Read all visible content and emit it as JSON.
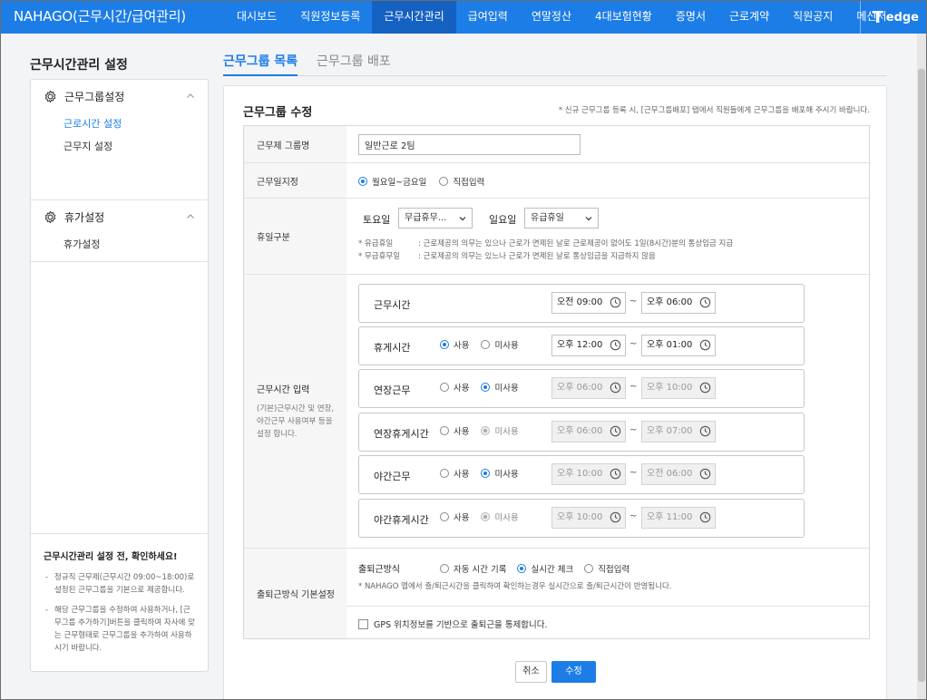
{
  "app": {
    "brand": "NAHAGO(근무시간/급여관리)",
    "logo_text": "edge"
  },
  "nav": [
    {
      "label": "대시보드"
    },
    {
      "label": "직원정보등록"
    },
    {
      "label": "근무시간관리"
    },
    {
      "label": "급여입력"
    },
    {
      "label": "연말정산"
    },
    {
      "label": "4대보험현황"
    },
    {
      "label": "증명서"
    },
    {
      "label": "근로계약"
    },
    {
      "label": "직원공지"
    },
    {
      "label": "메신저"
    }
  ],
  "nav_active": "근무시간관리",
  "sidebar": {
    "title": "근무시간관리 설정",
    "groups": [
      {
        "label": "근무그룹설정",
        "items": [
          "근로시간 설정",
          "근무지 설정"
        ]
      },
      {
        "label": "휴가설정",
        "items": [
          "휴가설정"
        ]
      }
    ],
    "active_item": "근로시간 설정",
    "notice": {
      "title": "근무시간관리 설정 전, 확인하세요!",
      "items": [
        "정규직 근무제(근무시간 09:00~18:00)로 설정된 근무그룹을 기본으로 제공합니다.",
        "해당 근무그룹을 수정하여 사용하거나, [근무그룹 추가하기]버튼을 클릭하여 자사에 맞는 근무형태로 근무그룹을 추가하여 사용하시기 바랍니다."
      ]
    }
  },
  "tabs": [
    {
      "label": "근무그룹 목록"
    },
    {
      "label": "근무그룹 배포"
    }
  ],
  "tab_active": "근무그룹 목록",
  "form": {
    "title": "근무그룹 수정",
    "note": "* 신규 근무그룹 등록 시, [근무그룹배포] 탭에서 직원들에게 근무그룹을 배포해 주시기 바랍니다.",
    "group_name": {
      "label": "근무제 그룹명",
      "value": "일반근로 2팀"
    },
    "work_days": {
      "label": "근무일지정",
      "options": [
        "월요일~금요일",
        "직접입력"
      ],
      "selected": "월요일~금요일"
    },
    "holiday": {
      "label": "휴일구분",
      "sat_label": "토요일",
      "sat_value": "무급휴무...",
      "sun_label": "일요일",
      "sun_value": "유급휴일",
      "hint1_key": "* 유급휴일",
      "hint1_text": ": 근로제공의 의무는 있으나 근로가 면제된 날로 근로제공이 없어도 1일(8시간)분의 통상임금 지급",
      "hint2_key": "* 무급휴무일",
      "hint2_text": ": 근로제공의 의무는 있느나 근로가 면제된 날로 통상임금을 지급하지 않음"
    },
    "work_time": {
      "label": "근무시간 입력",
      "desc": "(기본)근무시간 및 연장, 야간근무 사용여부 등을 설정 합니다.",
      "use_label": "사용",
      "nouse_label": "미사용",
      "tilde": "~",
      "blocks": [
        {
          "title": "근무시간",
          "has_radio": false,
          "selected": "",
          "disabled_radio": false,
          "start": "오전 09:00",
          "end": "오후 06:00",
          "time_disabled": false
        },
        {
          "title": "휴게시간",
          "has_radio": true,
          "selected": "use",
          "disabled_radio": false,
          "start": "오후 12:00",
          "end": "오후 01:00",
          "time_disabled": false
        },
        {
          "title": "연장근무",
          "has_radio": true,
          "selected": "nouse",
          "disabled_radio": false,
          "start": "오후 06:00",
          "end": "오후 10:00",
          "time_disabled": true
        },
        {
          "title": "연장휴게시간",
          "has_radio": true,
          "selected": "nouse",
          "disabled_radio": true,
          "start": "오후 06:00",
          "end": "오후 07:00",
          "time_disabled": true
        },
        {
          "title": "야간근무",
          "has_radio": true,
          "selected": "nouse",
          "disabled_radio": false,
          "start": "오후 10:00",
          "end": "오전 06:00",
          "time_disabled": true
        },
        {
          "title": "야간휴게시간",
          "has_radio": true,
          "selected": "nouse",
          "disabled_radio": true,
          "start": "오후 10:00",
          "end": "오후 11:00",
          "time_disabled": true
        }
      ]
    },
    "attendance": {
      "label": "출퇴근방식 기본설정",
      "method_label": "출퇴근방식",
      "options": [
        "자동 시간 기록",
        "실시간 체크",
        "직접입력"
      ],
      "selected": "실시간 체크",
      "hint": "* NAHAGO 앱에서 출/퇴근시간을 클릭하여 확인하는경우 실시간으로 출/퇴근시간이 반영됩니다.",
      "gps_label": "GPS 위치정보를 기반으로 출퇴근을 통제합니다."
    },
    "cancel_label": "취소",
    "submit_label": "수정"
  },
  "colors": {
    "primary": "#1d7de6",
    "nav_active": "#1561c2"
  }
}
